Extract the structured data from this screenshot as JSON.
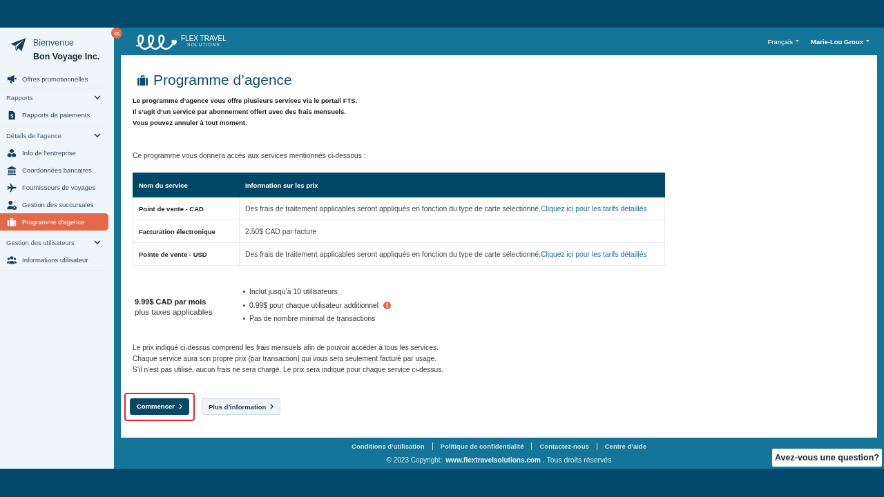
{
  "sidebar": {
    "greeting": "Bienvenue",
    "company": "Bon Voyage Inc.",
    "nav": [
      {
        "kind": "link",
        "label": "Offres promotionnelles",
        "selected": false
      },
      {
        "kind": "group",
        "label": "Rapports",
        "expanded": true,
        "children": [
          {
            "label": "Rapports de paiements",
            "selected": false
          }
        ]
      },
      {
        "kind": "group",
        "label": "Détails de l'agence",
        "expanded": true,
        "children": [
          {
            "label": "Info de l'entreprise",
            "selected": false
          },
          {
            "label": "Coordonnées bancaires",
            "selected": false
          },
          {
            "label": "Fournisseurs de voyages",
            "selected": false
          },
          {
            "label": "Gestion des succursales",
            "selected": false
          },
          {
            "label": "Programme d'agence",
            "selected": true
          }
        ]
      },
      {
        "kind": "group",
        "label": "Gestion des utilisateurs",
        "expanded": true,
        "children": [
          {
            "label": "Informations utilisateur",
            "selected": false
          }
        ]
      }
    ]
  },
  "header": {
    "brand": "FLEX TRAVEL",
    "brand_tagline": "SOLUTIONS",
    "language": "Français",
    "user": "Marie-Lou Groux"
  },
  "page": {
    "title": "Programme d’agence",
    "intro_lines": [
      "Le programme d’agence vous offre plusieurs services via le portail FTS.",
      "Il s’agit d’un service par abonnement offert avec des frais mensuels.",
      "Vous pouvez annuler à tout moment."
    ],
    "services_lead": "Ce programme vous donnera accès aux services mentionnés ci-dessous :",
    "table": {
      "columns": [
        "Nom du service",
        "Information sur les prix"
      ],
      "rows": [
        {
          "service": "Point de vente - CAD",
          "info": "Des frais de traitement applicables seront appliqués en fonction du type de carte sélectionné.",
          "link": "Cliquez ici pour les tarifs détaillés"
        },
        {
          "service": "Facturation électronique",
          "info": "2.50$ CAD par facture"
        },
        {
          "service": "Pointe de vente - USD",
          "info": "Des frais de traitement applicables seront appliqués en fonction du type de carte sélectionné.",
          "link": "Cliquez ici pour les tarifs détaillés"
        }
      ]
    },
    "price": {
      "amount": "9.99$ CAD par mois",
      "note": "plus taxes applicables"
    },
    "features": [
      {
        "text": "Inclut jusqu’à 10 utilisateurs",
        "info": false
      },
      {
        "text": "0.99$ pour chaque utilisateur additionnel",
        "info": true
      },
      {
        "text": "Pas de nombre minimal de transactions",
        "info": false
      }
    ],
    "notes_lines": [
      "Le prix indiqué ci-dessus comprend les frais mensuels afin de pouvoir accéder à tous les services.",
      "Chaque service aura son propre prix (par transaction) qui vous sera seulement facturé par usage.",
      "S’il n’est pas utilisé, aucun frais ne sera chargé. Le prix sera indiqué pour chaque service ci-dessus."
    ],
    "actions": [
      {
        "label": "Commencer",
        "kind": "primary",
        "highlighted": true
      },
      {
        "label": "Plus d’information",
        "kind": "secondary",
        "highlighted": false
      }
    ]
  },
  "footer": {
    "links": [
      "Conditions d’utilisation",
      "Politique de confidentialité",
      "Contactez-nous",
      "Centre d’aide"
    ],
    "copyright": {
      "prefix": "© 2023 Copyright:",
      "link": "www.flextravelsolutions.com",
      "suffix": ". Tous droits réservés"
    }
  },
  "help_button": "Avez-vous une question?"
}
